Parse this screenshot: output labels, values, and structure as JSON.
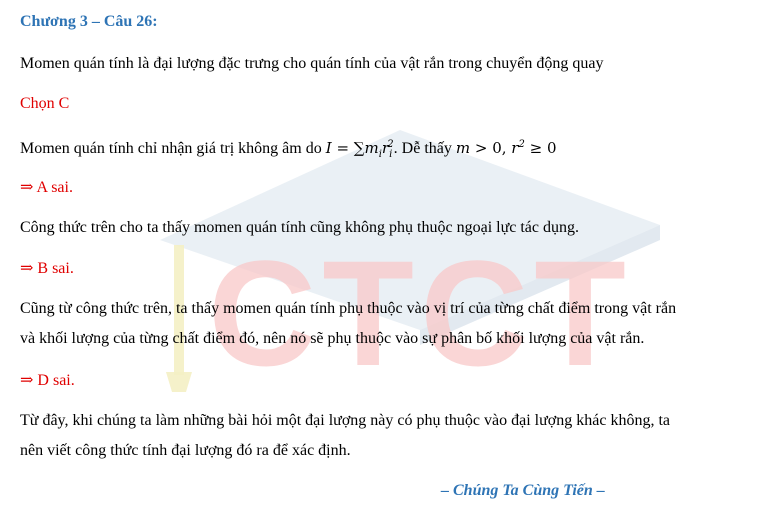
{
  "heading": "Chương 3 – Câu 26:",
  "paragraphs": {
    "p1": "Momen quán tính là đại lượng đặc trưng cho quán tính của vật rắn trong chuyển động quay",
    "choice": "Chọn C",
    "p2_prefix": "Momen quán tính chỉ nhận giá trị không âm do",
    "p2_middle": ". Dễ thấy",
    "verdict_a": "⇒ A sai.",
    "p3": "Công thức trên cho ta thấy momen quán tính cũng không phụ thuộc ngoại lực tác dụng.",
    "verdict_b": "⇒ B sai.",
    "p4_line1": "Cũng từ công thức trên, ta thấy momen quán tính phụ thuộc vào vị trí của từng chất điểm trong vật rắn",
    "p4_line2": "và khối lượng của từng chất điểm đó, nên nó sẽ phụ thuộc vào sự phân bố khối lượng của vật rắn.",
    "verdict_d": "⇒ D sai.",
    "p5_line1": "Từ đây, khi chúng ta làm những bài hỏi một đại lượng này có phụ thuộc vào đại lượng khác không, ta",
    "p5_line2": "nên viết công thức tính đại lượng đó ra để xác định."
  },
  "math": {
    "formula_lhs": "I",
    "formula_eq": " = ∑",
    "formula_m": "m",
    "formula_i1": "i",
    "formula_r": "r",
    "formula_i2": "i",
    "formula_exp": "2",
    "cond_m": "m",
    "cond_gt": " > 0, ",
    "cond_r": "r",
    "cond_exp": "2",
    "cond_ge": " ≥ 0"
  },
  "footer": "– Chúng Ta Cùng Tiến –",
  "watermark": {
    "text": "CTCT",
    "color": "#f9c9c9",
    "cap_color": "#e3eaf1"
  }
}
